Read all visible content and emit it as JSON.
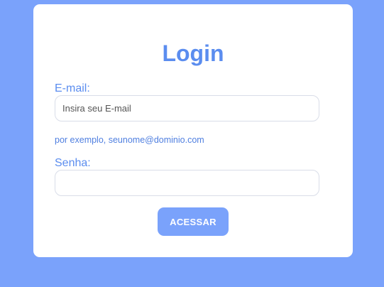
{
  "login": {
    "title": "Login",
    "email_label": "E-mail:",
    "email_placeholder": "Insira seu E-mail",
    "email_value": "",
    "email_hint": "por exemplo, seunome@dominio.com",
    "password_label": "Senha:",
    "password_placeholder": "",
    "password_value": "",
    "submit_label": "ACESSAR"
  },
  "colors": {
    "background": "#7aa2fb",
    "card": "#ffffff",
    "accent_text": "#5b8def",
    "button": "#7aa2fb",
    "button_text": "#ffffff"
  }
}
